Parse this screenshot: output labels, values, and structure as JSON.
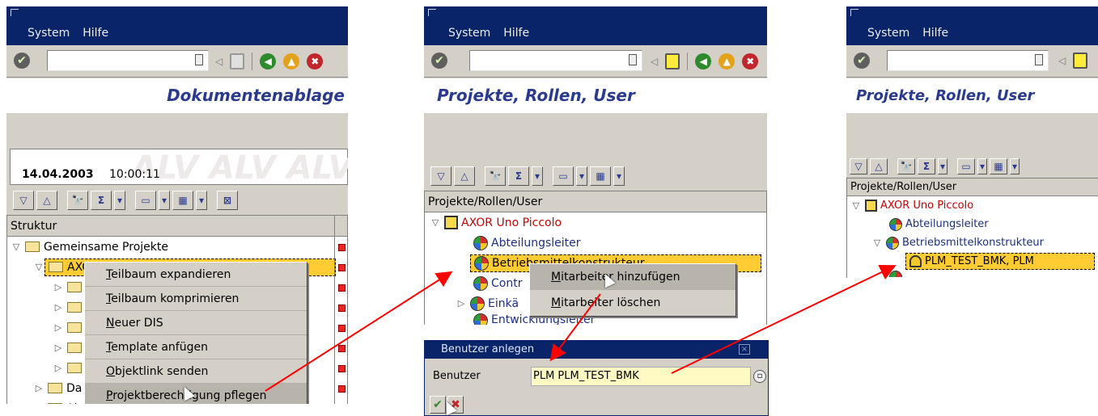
{
  "menu": {
    "system": "System",
    "help": "Hilfe"
  },
  "screen1": {
    "title": "Dokumentenablage",
    "date": "14.04.2003",
    "time": "10:00:11",
    "alv_watermark": "ALV ALV ALV A",
    "column_header": "Struktur",
    "rows": [
      "Gemeinsame Projekte",
      "AXO",
      "",
      "",
      "",
      "",
      "",
      "Da",
      "Ab"
    ],
    "context_menu": [
      "Teilbaum expandieren",
      "Teilbaum komprimieren",
      "Neuer DIS",
      "Template anfügen",
      "Objektlink senden",
      "Projektberechtigung pflegen"
    ]
  },
  "screen2": {
    "title": "Projekte, Rollen, User",
    "column_header": "Projekte/Rollen/User",
    "project": "AXOR Uno Piccolo",
    "roles": [
      "Abteilungsleiter",
      "Betriebsmittelkonstrukteur",
      "Contr",
      "Einkä",
      "Entwicklungsleiter"
    ],
    "context_menu": [
      "Mitarbeiter hinzufügen",
      "Mitarbeiter löschen"
    ]
  },
  "dialog": {
    "title": "Benutzer anlegen",
    "label": "Benutzer",
    "value": "PLM PLM_TEST_BMK",
    "ok": "✔",
    "cancel": "✖"
  },
  "screen3": {
    "title": "Projekte, Rollen, User",
    "column_header": "Projekte/Rollen/User",
    "project": "AXOR Uno Piccolo",
    "roles": [
      "Abteilungsleiter",
      "Betriebsmittelkonstrukteur"
    ],
    "user": "PLM_TEST_BMK, PLM"
  },
  "icons": [
    "enter-icon",
    "back-icon",
    "save-icon",
    "exit-icon",
    "cancel-icon",
    "find-icon",
    "sum-icon",
    "print-icon",
    "layout-icon"
  ],
  "colors": {
    "titlebar": "#0a246a",
    "title_text": "#2a3b8f",
    "arrow": "#ff0000",
    "selection": "#ffcc33"
  }
}
